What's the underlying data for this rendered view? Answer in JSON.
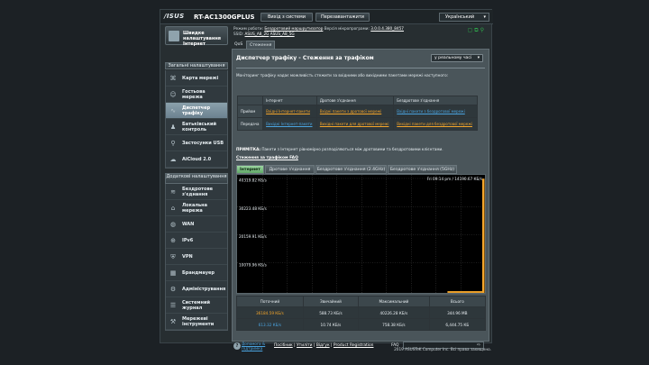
{
  "header": {
    "logo": "/ISUS",
    "model": "RT-AC1300GPLUS",
    "logout": "Вихід з системи",
    "reboot": "Перезавантажити",
    "language": "Український"
  },
  "status": {
    "mode_label": "Режим роботи:",
    "mode_value": "Бездротовий маршрутизатор",
    "fw_label": "Версія мікропрограми:",
    "fw_value": "3.0.0.4.380_8457",
    "ssid_label": "SSID:",
    "ssid_1": "ASUS_A8_2G",
    "ssid_2": "ASUS_A8_5G"
  },
  "sidebar": {
    "qis_label": "Швидке налаштування Інтернет",
    "general_title": "Загальні налаштування",
    "general_items": [
      {
        "label": "Карта мережі"
      },
      {
        "label": "Гостьова мережа"
      },
      {
        "label": "Диспетчер трафіку"
      },
      {
        "label": "Батьківський контроль"
      },
      {
        "label": "Застосунки USB"
      },
      {
        "label": "AiCloud 2.0"
      }
    ],
    "advanced_title": "Додаткові налаштування",
    "advanced_items": [
      {
        "label": "Бездротове з'єднання"
      },
      {
        "label": "Локальна мережа"
      },
      {
        "label": "WAN"
      },
      {
        "label": "IPv6"
      },
      {
        "label": "VPN"
      },
      {
        "label": "Брандмауер"
      },
      {
        "label": "Адміністрування"
      },
      {
        "label": "Системний журнал"
      },
      {
        "label": "Мережеві інструменти"
      }
    ]
  },
  "tabs": [
    "QoS",
    "Стеження за трафіком"
  ],
  "main": {
    "title": "Диспетчер трафіку - Стеження за трафіком",
    "mode_select": "у реальному часі",
    "description": "Моніторинг трафіку надає можливість стежити за вхідними або вихідними пакетами мережі наступного:",
    "table": {
      "headers": [
        "",
        "Інтернет",
        "Дротове з'єднання",
        "Бездротове з'єднання"
      ],
      "rows": [
        {
          "label": "Прийом",
          "cells": [
            "Вхідні Інтернет-пакети",
            "Вхідні пакети з дротової мережі",
            "Вхідні пакети з бездротової мережі"
          ]
        },
        {
          "label": "Передача",
          "cells": [
            "Вихідні Інтернет-пакети",
            "Вихідні пакети для дротової мережі",
            "Вихідні пакети для бездротової мережі"
          ]
        }
      ]
    },
    "note_label": "ПРИМІТКА:",
    "note_text": "Пакети з Інтернет рівномірно розподіляються між дротовими та бездротовими клієнтами.",
    "faq_link": "Стеження за трафіком FAQ"
  },
  "chart_tabs": [
    "Інтернет",
    "Дротове з'єднання",
    "Бездротове з'єднання (2.4GHz)",
    "Бездротове з'єднання (5GHz)"
  ],
  "chart_data": {
    "type": "area",
    "y_ticks": [
      "40319.82 КБ/s",
      "30223.48 КБ/s",
      "20159.91 КБ/s",
      "10079.96 КБ/s"
    ],
    "ylim": [
      0,
      40319.82
    ],
    "readout": "Fri 09:14 pm / 14190.67 КБ/s",
    "series": [
      {
        "values": [
          0,
          0,
          0,
          0,
          0,
          0,
          0,
          0,
          0,
          0,
          0,
          0,
          0,
          0,
          0,
          0,
          0,
          0,
          0,
          0,
          0,
          0,
          0,
          0,
          0,
          0,
          0,
          0,
          0,
          40226.28
        ]
      }
    ]
  },
  "stats": {
    "headers": [
      "Поточний",
      "Звичайний",
      "Максимальний",
      "Всього"
    ],
    "rows": [
      [
        "36184.59 КБ/s",
        "588.73 КБ/s",
        "40226.28 КБ/s",
        "344.96 MB"
      ],
      [
        "613.32 КБ/s",
        "10.74 КБ/s",
        "758.38 КБ/s",
        "6,444.75 КБ"
      ]
    ]
  },
  "footer": {
    "help": "?",
    "manual": "Допомога & Підтримка",
    "links": [
      "Посібник",
      "Утиліти",
      "Відгук",
      "Product Registration"
    ],
    "faq": "FAQ",
    "copyright": "2019 ASUSTeK Computer Inc. Всі права захищено."
  },
  "colors": {
    "accent_active_tab": "#7bc383",
    "rx": "#f4a52a",
    "tx": "#4aa3df",
    "status_green": "#2fb14d"
  }
}
